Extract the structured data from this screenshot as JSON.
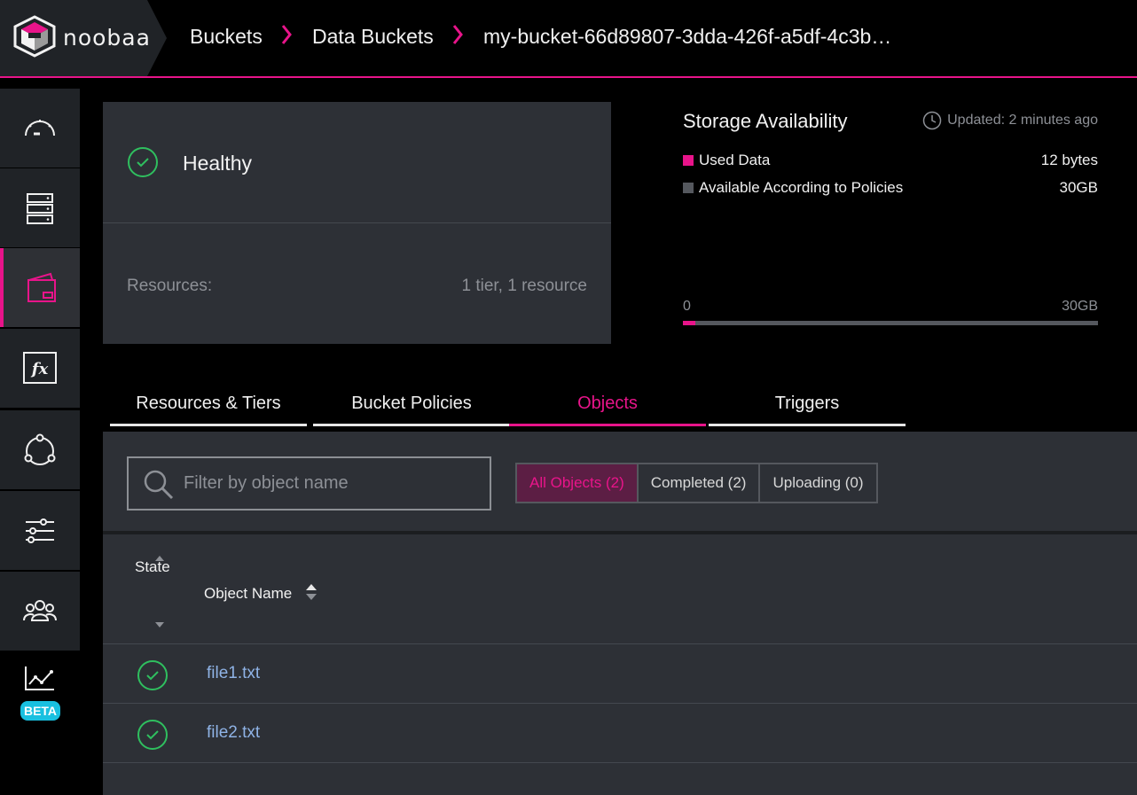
{
  "brand": {
    "logo_text": "noobaa",
    "accent": "#e8148a"
  },
  "breadcrumb": [
    {
      "label": "Buckets"
    },
    {
      "label": "Data Buckets"
    },
    {
      "label": "my-bucket-66d89807-3dda-426f-a5df-4c3b…"
    }
  ],
  "sidebar": {
    "items": [
      {
        "icon": "dashboard-gauge-icon",
        "active": false
      },
      {
        "icon": "resources-server-icon",
        "active": false
      },
      {
        "icon": "buckets-wallet-icon",
        "active": true
      },
      {
        "icon": "functions-fx-icon",
        "active": false
      },
      {
        "icon": "cluster-nodes-icon",
        "active": false
      },
      {
        "icon": "settings-sliders-icon",
        "active": false
      },
      {
        "icon": "accounts-users-icon",
        "active": false
      },
      {
        "icon": "analytics-chart-icon",
        "active": false,
        "badge": "BETA"
      }
    ]
  },
  "health": {
    "status": "Healthy",
    "status_color": "#2fbf5f",
    "resources_label": "Resources:",
    "resources_value": "1 tier, 1 resource"
  },
  "storage": {
    "title": "Storage Availability",
    "updated": "Updated: 2 minutes ago",
    "legend": [
      {
        "label": "Used Data",
        "value": "12 bytes",
        "color": "#e8148a"
      },
      {
        "label": "Available According to Policies",
        "value": "30GB",
        "color": "#55585e"
      }
    ],
    "axis_min": "0",
    "axis_max": "30GB",
    "used_fraction": 0.03
  },
  "tabs": [
    {
      "label": "Resources & Tiers",
      "active": false
    },
    {
      "label": "Bucket Policies",
      "active": false
    },
    {
      "label": "Objects",
      "active": true
    },
    {
      "label": "Triggers",
      "active": false
    }
  ],
  "objects": {
    "search_placeholder": "Filter by object name",
    "filters": [
      {
        "label": "All Objects (2)",
        "active": true
      },
      {
        "label": "Completed (2)",
        "active": false
      },
      {
        "label": "Uploading (0)",
        "active": false
      }
    ],
    "columns": {
      "state": "State",
      "name": "Object Name"
    },
    "rows": [
      {
        "state": "completed",
        "name": "file1.txt"
      },
      {
        "state": "completed",
        "name": "file2.txt"
      }
    ]
  }
}
